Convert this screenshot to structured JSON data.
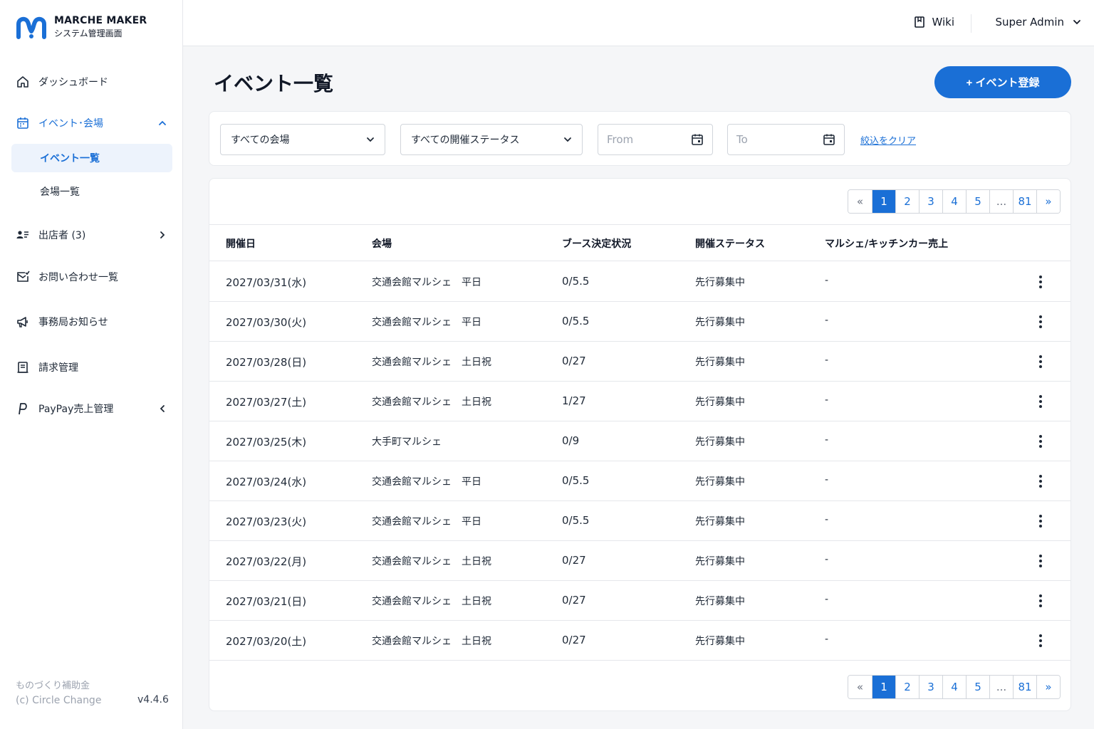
{
  "brand": {
    "title": "MARCHE MAKER",
    "subtitle": "システム管理画面",
    "logo_color": "#1a6fd6"
  },
  "sidebar": {
    "items": [
      {
        "label": "ダッシュボード",
        "icon": "home-icon"
      },
      {
        "label": "イベント･会場",
        "icon": "calendar-icon"
      },
      {
        "label": "出店者 (3)",
        "icon": "users-list-icon"
      },
      {
        "label": "お問い合わせ一覧",
        "icon": "mail-check-icon"
      },
      {
        "label": "事務局お知らせ",
        "icon": "megaphone-icon"
      },
      {
        "label": "請求管理",
        "icon": "receipt-icon"
      },
      {
        "label": "PayPay売上管理",
        "icon": "paypay-icon"
      }
    ],
    "sub_items": [
      {
        "label": "イベント一覧",
        "selected": true
      },
      {
        "label": "会場一覧",
        "selected": false
      }
    ],
    "footer": {
      "line1": "ものづくり補助金",
      "line2": "(c) Circle Change",
      "version": "v4.4.6"
    }
  },
  "topbar": {
    "wiki_label": "Wiki",
    "user_label": "Super Admin"
  },
  "page": {
    "title": "イベント一覧",
    "add_button": "+ イベント登録"
  },
  "filters": {
    "venue_select": "すべての会場",
    "status_select": "すべての開催ステータス",
    "from_placeholder": "From",
    "to_placeholder": "To",
    "clear_label": "絞込をクリア"
  },
  "pagination": {
    "first": "«",
    "pages": [
      "1",
      "2",
      "3",
      "4",
      "5"
    ],
    "ellipsis": "...",
    "last_page": "81",
    "next": "»",
    "current": "1"
  },
  "table": {
    "headers": [
      "開催日",
      "会場",
      "ブース決定状況",
      "開催ステータス",
      "マルシェ/キッチンカー売上"
    ],
    "rows": [
      {
        "date": "2027/03/31(水)",
        "venue": "交通会館マルシェ　平日",
        "booth": "0/5.5",
        "status": "先行募集中",
        "sales": "-"
      },
      {
        "date": "2027/03/30(火)",
        "venue": "交通会館マルシェ　平日",
        "booth": "0/5.5",
        "status": "先行募集中",
        "sales": "-"
      },
      {
        "date": "2027/03/28(日)",
        "venue": "交通会館マルシェ　土日祝",
        "booth": "0/27",
        "status": "先行募集中",
        "sales": "-"
      },
      {
        "date": "2027/03/27(土)",
        "venue": "交通会館マルシェ　土日祝",
        "booth": "1/27",
        "status": "先行募集中",
        "sales": "-"
      },
      {
        "date": "2027/03/25(木)",
        "venue": "大手町マルシェ",
        "booth": "0/9",
        "status": "先行募集中",
        "sales": "-"
      },
      {
        "date": "2027/03/24(水)",
        "venue": "交通会館マルシェ　平日",
        "booth": "0/5.5",
        "status": "先行募集中",
        "sales": "-"
      },
      {
        "date": "2027/03/23(火)",
        "venue": "交通会館マルシェ　平日",
        "booth": "0/5.5",
        "status": "先行募集中",
        "sales": "-"
      },
      {
        "date": "2027/03/22(月)",
        "venue": "交通会館マルシェ　土日祝",
        "booth": "0/27",
        "status": "先行募集中",
        "sales": "-"
      },
      {
        "date": "2027/03/21(日)",
        "venue": "交通会館マルシェ　土日祝",
        "booth": "0/27",
        "status": "先行募集中",
        "sales": "-"
      },
      {
        "date": "2027/03/20(土)",
        "venue": "交通会館マルシェ　土日祝",
        "booth": "0/27",
        "status": "先行募集中",
        "sales": "-"
      }
    ]
  }
}
